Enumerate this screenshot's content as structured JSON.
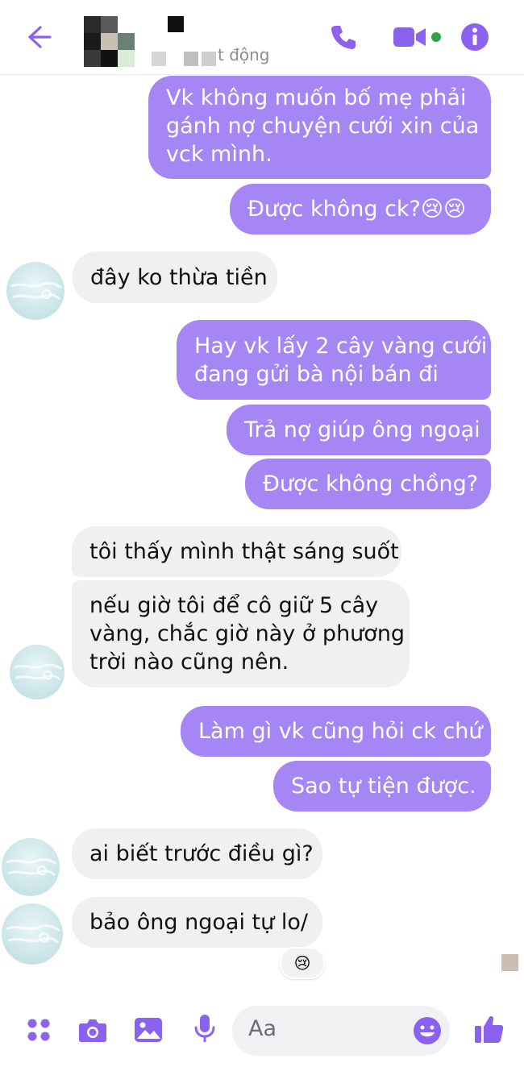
{
  "header": {
    "status_fragment": "t động",
    "icons": [
      "back-arrow-icon",
      "phone-icon",
      "video-camera-icon",
      "info-icon"
    ],
    "accent_color": "#8b62f0",
    "online_color": "#31a24c"
  },
  "messages": [
    {
      "from": "me",
      "lines": [
        "Vk không muốn bố mẹ phải",
        "gánh nợ chuyện cưới xin của",
        "vck mình."
      ]
    },
    {
      "from": "me",
      "lines": [
        "Được không ck?😢😢"
      ]
    },
    {
      "from": "them",
      "lines": [
        "đây ko thừa tiền"
      ]
    },
    {
      "from": "me",
      "lines": [
        "Hay vk lấy 2 cây vàng cưới",
        "đang gửi bà nội bán đi"
      ]
    },
    {
      "from": "me",
      "lines": [
        "Trả nợ giúp ông ngoại"
      ]
    },
    {
      "from": "me",
      "lines": [
        "Được không chồng?"
      ]
    },
    {
      "from": "them",
      "lines": [
        "tôi thấy mình thật sáng suốt"
      ]
    },
    {
      "from": "them",
      "lines": [
        "nếu giờ tôi để cô giữ 5 cây",
        "vàng, chắc giờ này ở phương",
        "trời nào cũng nên."
      ]
    },
    {
      "from": "me",
      "lines": [
        "Làm gì vk cũng hỏi ck chứ"
      ]
    },
    {
      "from": "me",
      "lines": [
        "Sao tự tiện được."
      ]
    },
    {
      "from": "them",
      "lines": [
        "ai biết trước điều gì?"
      ]
    },
    {
      "from": "them",
      "lines": [
        "bảo ông ngoại tự lo/"
      ]
    }
  ],
  "reaction": "😢",
  "composer": {
    "placeholder": "Aa",
    "icons": [
      "apps-icon",
      "camera-icon",
      "gallery-icon",
      "microphone-icon",
      "emoji-icon",
      "thumbs-up-icon"
    ]
  },
  "colors": {
    "sent_bubble": "#a685f5",
    "received_bubble": "#eff0f2"
  }
}
